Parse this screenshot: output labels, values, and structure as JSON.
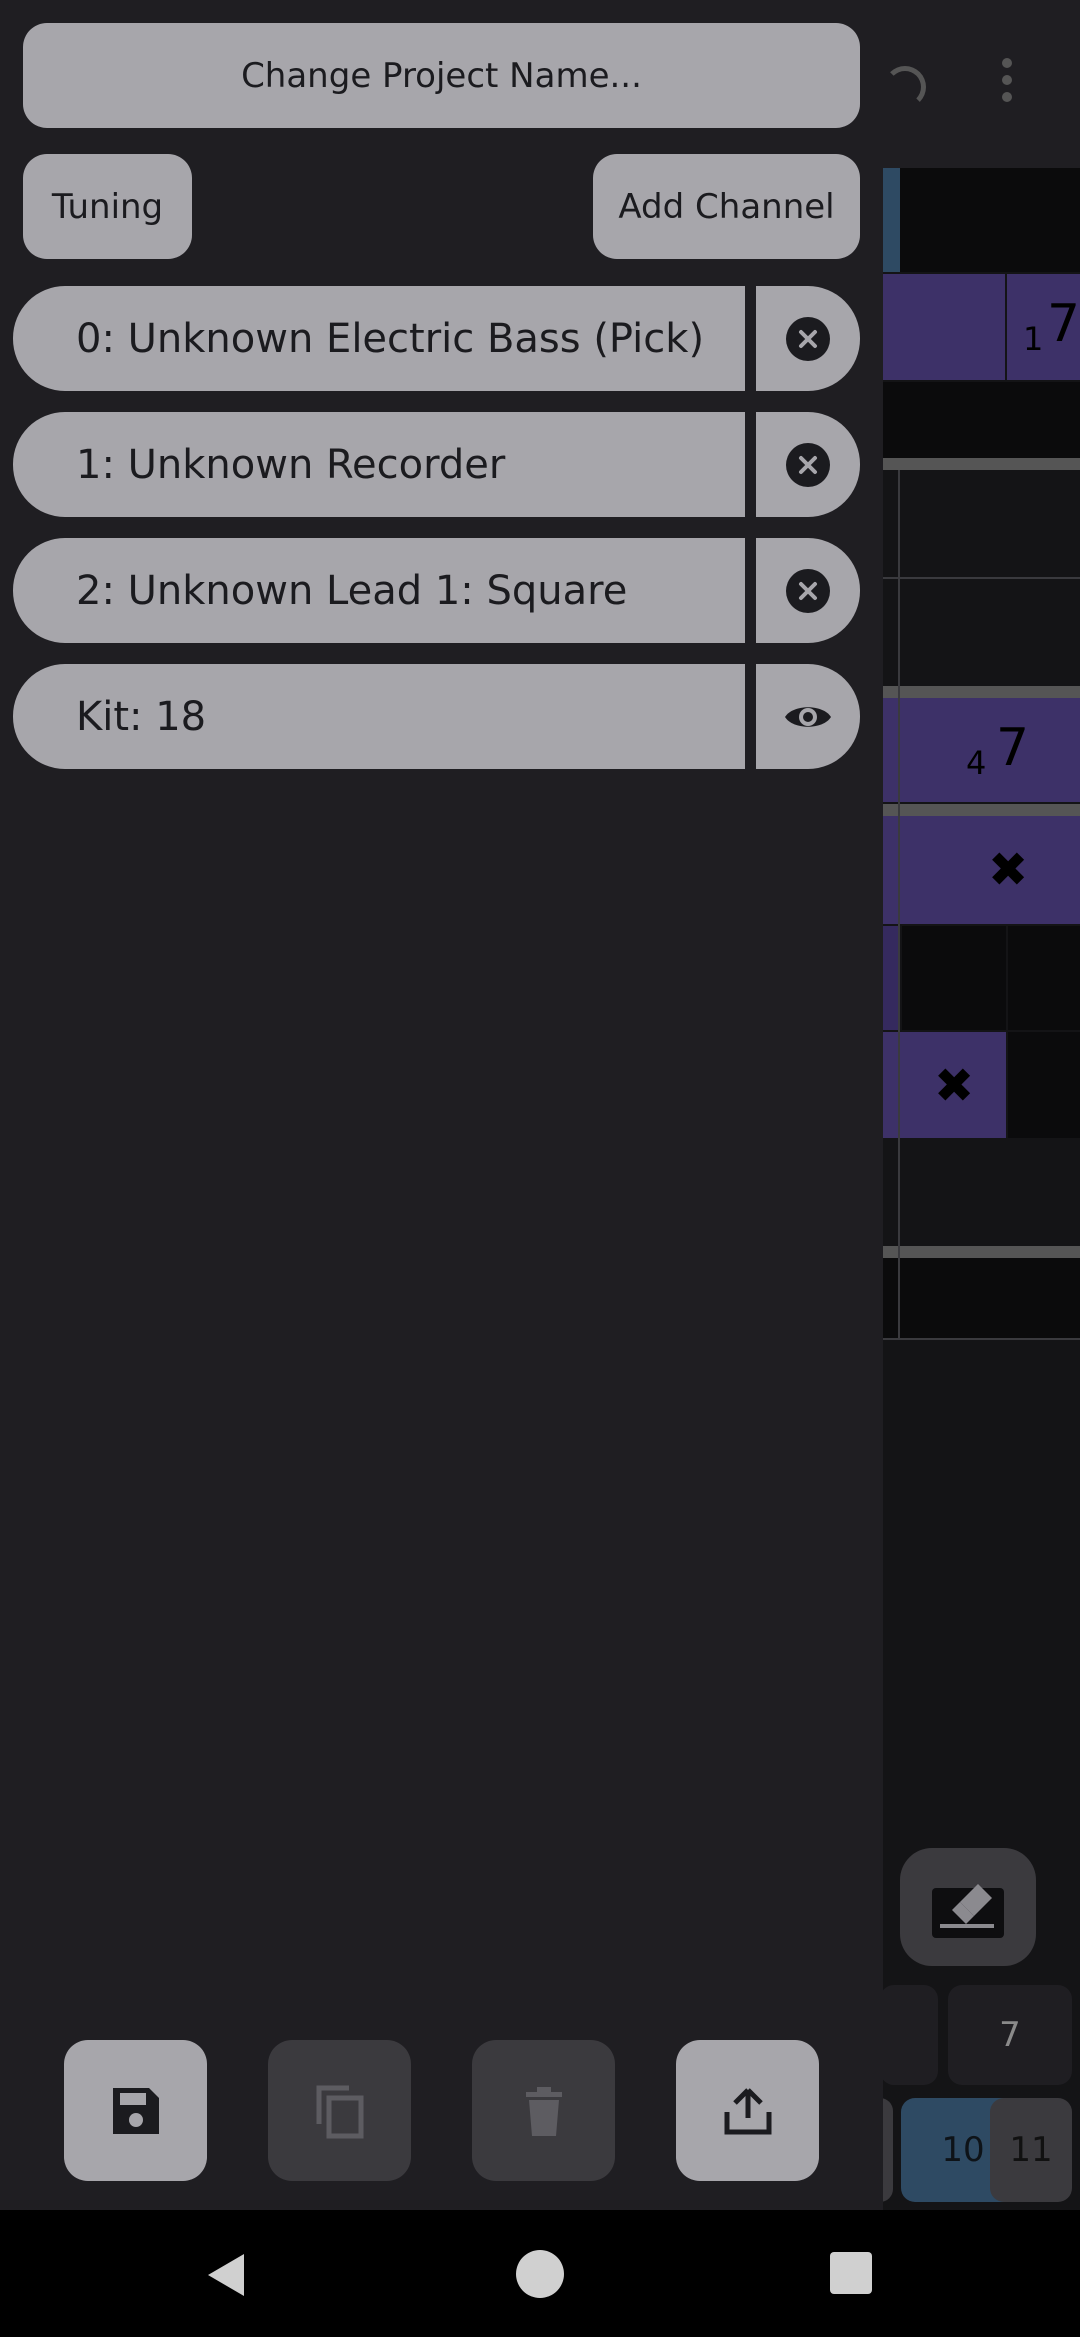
{
  "drawer": {
    "change_name_label": "Change Project Name...",
    "tuning_label": "Tuning",
    "add_channel_label": "Add Channel",
    "channels": [
      {
        "label": "0: Unknown Electric Bass (Pick)",
        "action_icon": "remove-channel-icon"
      },
      {
        "label": "1: Unknown Recorder",
        "action_icon": "remove-channel-icon"
      },
      {
        "label": "2: Unknown Lead 1: Square",
        "action_icon": "remove-channel-icon"
      },
      {
        "label": "Kit: 18",
        "action_icon": "visibility-eye-icon"
      }
    ],
    "toolbar": [
      {
        "name": "save-project-button",
        "icon": "save-icon",
        "enabled": true
      },
      {
        "name": "copy-project-button",
        "icon": "copy-icon",
        "enabled": false
      },
      {
        "name": "delete-project-button",
        "icon": "trash-icon",
        "enabled": false
      },
      {
        "name": "export-project-button",
        "icon": "share-upload-icon",
        "enabled": true
      }
    ]
  },
  "background": {
    "cells": [
      {
        "big": "7",
        "small": "1"
      },
      {
        "big": "7",
        "small": "4"
      }
    ],
    "keypad": [
      "7",
      "10",
      "11"
    ]
  },
  "colors": {
    "drawer_bg": "#1f1e22",
    "button_bg": "#a7a6ab",
    "button_disabled_bg": "#3b3a3e",
    "note_purple": "#3d3168",
    "selected_blue": "#2e4a63"
  }
}
